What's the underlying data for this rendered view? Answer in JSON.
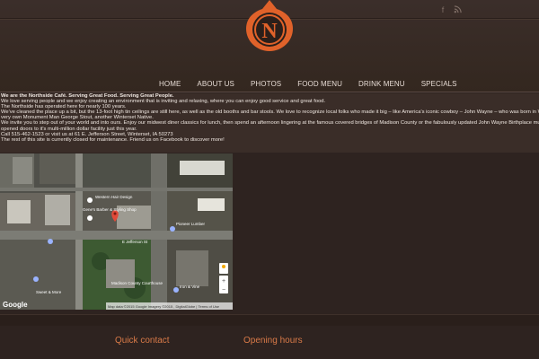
{
  "social": {
    "facebook_icon": "f",
    "rss_icon": "rss"
  },
  "logo": {
    "letter": "N",
    "accent": "#e0622a"
  },
  "nav": {
    "items": [
      {
        "label": "HOME"
      },
      {
        "label": "ABOUT US"
      },
      {
        "label": "PHOTOS"
      },
      {
        "label": "FOOD MENU"
      },
      {
        "label": "DRINK MENU"
      },
      {
        "label": "SPECIALS"
      }
    ]
  },
  "content": {
    "lines": [
      "We are the Northside Café.   Serving Great Food.   Serving Great People.",
      "We love serving people and we enjoy creating an environment that is inviting and relaxing, where you can enjoy good service and great food.",
      "The Northside has operated here for nearly 100 years.",
      "We've cleaned the place up a bit, but the 13-foot high tin ceilings are still here, as well as the old booths and bar stools.  We love to recognize local folks who made it big – like America's iconic cowboy – John Wayne – who was born in  Winterset, or our",
      "very own Monument Man George Stout, another Winterset Native.",
      "We invite you to step out of your world and into ours. Enjoy our midwest diner classics for lunch, then spend an afternoon lingering at the famous covered bridges of Madison County or the fabulously updated John Wayne Birthplace museum, which",
      "opened doors to it's multi-million dollar facility just this year.",
      "Call 515-462-1523 or visit us at 61 E. Jefferson Street, Winterset, IA 50273",
      "The rest of this site is currently closed for maintenance. Friend us on Facebook to discover more!"
    ]
  },
  "map": {
    "labels": {
      "hair": "Western Hair Design",
      "barber": "Gene's Barber & Styling Shop",
      "jefferson": "E Jefferson St",
      "court": "Madison County Courthouse",
      "lumber": "Pioneer Lumber",
      "iron": "Iron & Vine",
      "sweet": "Sweet & More",
      "attribution": "Map data ©2015 Google Imagery ©2015 , DigitalGlobe | Terms of Use",
      "google": "Google"
    }
  },
  "footer": {
    "quick_contact": "Quick contact",
    "opening_hours": "Opening hours"
  }
}
